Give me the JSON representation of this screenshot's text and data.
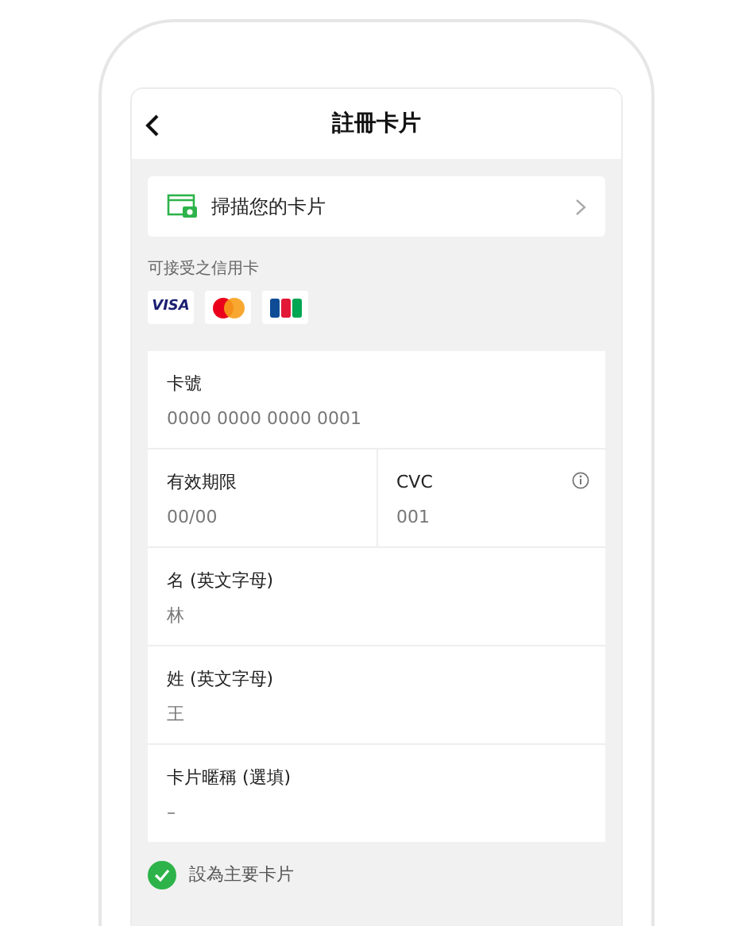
{
  "header": {
    "title": "註冊卡片"
  },
  "scan_row": {
    "label": "掃描您的卡片"
  },
  "accepted_cards": {
    "label": "可接受之信用卡",
    "cards": [
      {
        "kind": "visa",
        "label": "VISA"
      },
      {
        "kind": "mastercard"
      },
      {
        "kind": "jcb"
      }
    ]
  },
  "form_rows": [
    [
      {
        "label": "卡號",
        "value": "0000 0000 0000 0001"
      }
    ],
    [
      {
        "label": "有效期限",
        "value": "00/00"
      },
      {
        "label": "CVC",
        "value": "001",
        "info": true
      }
    ],
    [
      {
        "label": "名 (英文字母)",
        "value": "林"
      }
    ],
    [
      {
        "label": "姓 (英文字母)",
        "value": "王"
      }
    ],
    [
      {
        "label": "卡片暱稱 (選填)",
        "value": "–"
      }
    ]
  ],
  "primary_card": {
    "label": "設為主要卡片",
    "checked": true
  }
}
